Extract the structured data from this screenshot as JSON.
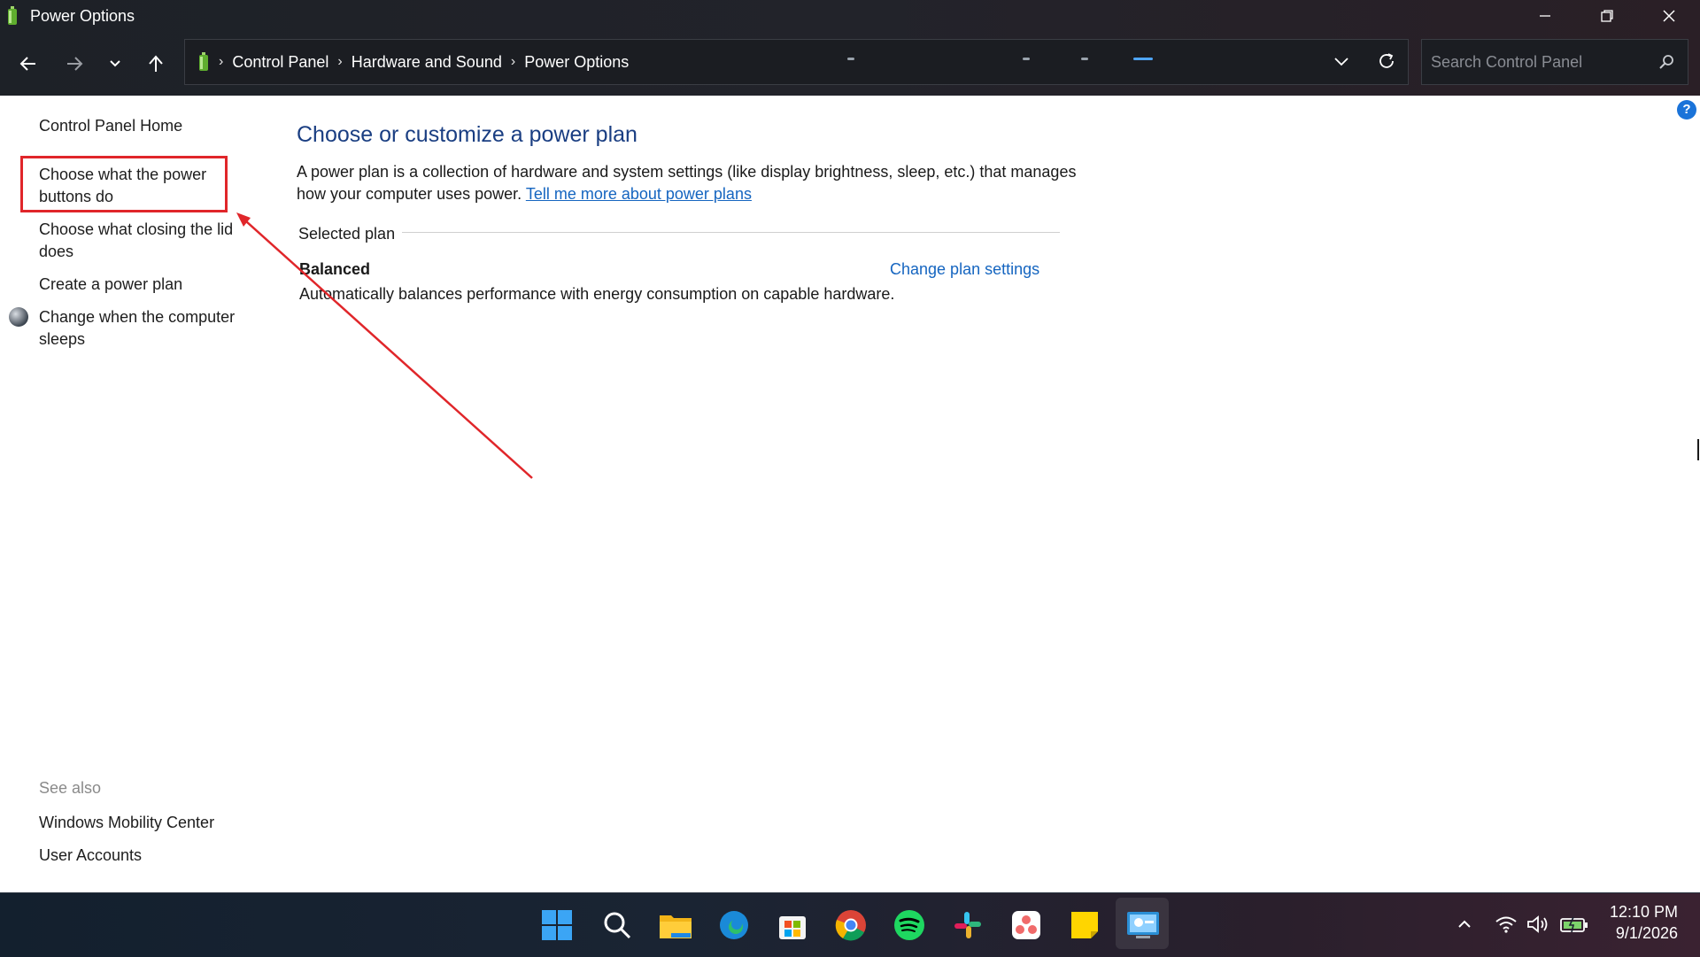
{
  "window": {
    "title": "Power Options"
  },
  "breadcrumb": [
    "Control Panel",
    "Hardware and Sound",
    "Power Options"
  ],
  "search": {
    "placeholder": "Search Control Panel"
  },
  "left_pane": {
    "home": "Control Panel Home",
    "links": [
      "Choose what the power buttons do",
      "Choose what closing the lid does",
      "Create a power plan",
      "Change when the computer sleeps"
    ],
    "see_also_label": "See also",
    "see_also_links": [
      "Windows Mobility Center",
      "User Accounts"
    ]
  },
  "main": {
    "heading": "Choose or customize a power plan",
    "description": "A power plan is a collection of hardware and system settings (like display brightness, sleep, etc.) that manages how your computer uses power.",
    "learn_more": "Tell me more about power plans",
    "selected_plan_label": "Selected plan",
    "plan": {
      "name": "Balanced",
      "change_link": "Change plan settings",
      "description": "Automatically balances performance with energy consumption on capable hardware."
    },
    "help": "?"
  },
  "taskbar": {
    "apps": [
      "windows-start",
      "search",
      "file-explorer",
      "edge",
      "microsoft-store",
      "chrome",
      "spotify",
      "slack",
      "asana",
      "sticky-notes",
      "control-panel"
    ],
    "clock": {
      "time": "12:10 PM",
      "date": "9/1/2026"
    }
  },
  "colors": {
    "accent": "#1a3e82",
    "link": "#1565c0",
    "annotation": "#e0262a"
  }
}
